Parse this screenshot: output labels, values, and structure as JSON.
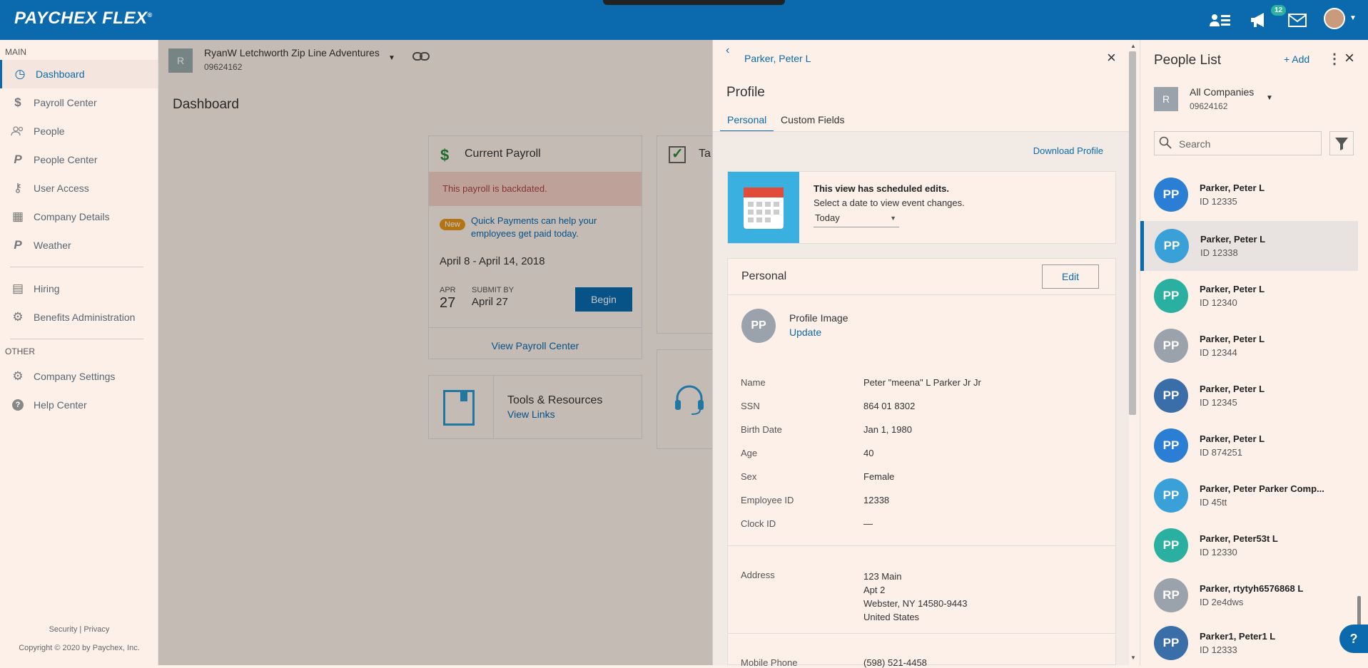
{
  "app": {
    "logo": "PAYCHEX FLEX",
    "logo_mark": "®",
    "notifications_count": "12"
  },
  "sidebar": {
    "main_label": "MAIN",
    "items": [
      {
        "label": "Dashboard",
        "icon": "dashboard-icon"
      },
      {
        "label": "Payroll Center",
        "icon": "dollar-icon"
      },
      {
        "label": "People",
        "icon": "people-icon"
      },
      {
        "label": "People Center",
        "icon": "p-logo-icon"
      },
      {
        "label": "User Access",
        "icon": "user-access-icon"
      },
      {
        "label": "Company Details",
        "icon": "building-icon"
      },
      {
        "label": "Weather",
        "icon": "p-logo-icon"
      },
      {
        "label": "Hiring",
        "icon": "hiring-icon"
      },
      {
        "label": "Benefits Administration",
        "icon": "benefits-icon"
      }
    ],
    "other_label": "OTHER",
    "other_items": [
      {
        "label": "Company Settings",
        "icon": "gear-icon"
      },
      {
        "label": "Help Center",
        "icon": "help-icon"
      }
    ],
    "footer_security": "Security",
    "footer_sep": "|",
    "footer_privacy": "Privacy",
    "copyright": "Copyright © 2020 by Paychex, Inc."
  },
  "main": {
    "company_initial": "R",
    "company_name": "RyanW Letchworth Zip Line Adventures",
    "company_id": "09624162",
    "page_title": "Dashboard",
    "current_payroll": {
      "title": "Current Payroll",
      "alert": "This payroll is backdated.",
      "new_badge": "New",
      "promo": "Quick Payments can help your employees get paid today.",
      "period": "April 8 - April 14, 2018",
      "month": "APR",
      "day": "27",
      "submit_by_label": "SUBMIT BY",
      "submit_by_date": "April 27",
      "begin": "Begin",
      "view_link": "View Payroll Center"
    },
    "second_card_title": "Ta",
    "tools": {
      "title": "Tools & Resources",
      "link": "View Links"
    }
  },
  "profile": {
    "back_label": "Parker, Peter L",
    "heading": "Profile",
    "tabs": [
      "Personal",
      "Custom Fields"
    ],
    "download": "Download Profile",
    "scheduled_title": "This view has scheduled edits.",
    "scheduled_sub": "Select a date to view event changes.",
    "date_select": "Today",
    "section_title": "Personal",
    "edit": "Edit",
    "avatar_initials": "PP",
    "profile_image_label": "Profile Image",
    "update_link": "Update",
    "fields": [
      {
        "label": "Name",
        "value": "Peter \"meena\" L Parker Jr Jr"
      },
      {
        "label": "SSN",
        "value": "864 01 8302"
      },
      {
        "label": "Birth Date",
        "value": "Jan 1, 1980"
      },
      {
        "label": "Age",
        "value": "40"
      },
      {
        "label": "Sex",
        "value": "Female"
      },
      {
        "label": "Employee ID",
        "value": "12338"
      },
      {
        "label": "Clock ID",
        "value": "—"
      }
    ],
    "address_label": "Address",
    "address_lines": [
      "123 Main",
      "Apt 2",
      "Webster, NY 14580-9443",
      "United States"
    ],
    "mobile_label": "Mobile Phone",
    "mobile_value": "(598) 521-4458"
  },
  "people_list": {
    "title": "People List",
    "add": "+ Add",
    "company_initial": "R",
    "company_name": "All Companies",
    "company_id": "09624162",
    "search_placeholder": "Search",
    "people": [
      {
        "initials": "PP",
        "name": "Parker, Peter L",
        "id": "ID 12335",
        "color": "#2a7fd4"
      },
      {
        "initials": "PP",
        "name": "Parker, Peter L",
        "id": "ID 12338",
        "color": "#3aa0d8",
        "selected": true
      },
      {
        "initials": "PP",
        "name": "Parker, Peter L",
        "id": "ID 12340",
        "color": "#2ab0a0"
      },
      {
        "initials": "PP",
        "name": "Parker, Peter L",
        "id": "ID 12344",
        "color": "#9aa3ab"
      },
      {
        "initials": "PP",
        "name": "Parker, Peter L",
        "id": "ID 12345",
        "color": "#3a6ea8"
      },
      {
        "initials": "PP",
        "name": "Parker, Peter L",
        "id": "ID 874251",
        "color": "#2a7fd4"
      },
      {
        "initials": "PP",
        "name": "Parker, Peter Parker Comp...",
        "id": "ID 45tt",
        "color": "#3aa0d8"
      },
      {
        "initials": "PP",
        "name": "Parker, Peter53t L",
        "id": "ID 12330",
        "color": "#2ab0a0"
      },
      {
        "initials": "RP",
        "name": "Parker, rtytyh6576868 L",
        "id": "ID 2e4dws",
        "color": "#9aa3ab"
      },
      {
        "initials": "PP",
        "name": "Parker1, Peter1 L",
        "id": "ID 12333",
        "color": "#3a6ea8"
      }
    ]
  },
  "help_button": "?"
}
